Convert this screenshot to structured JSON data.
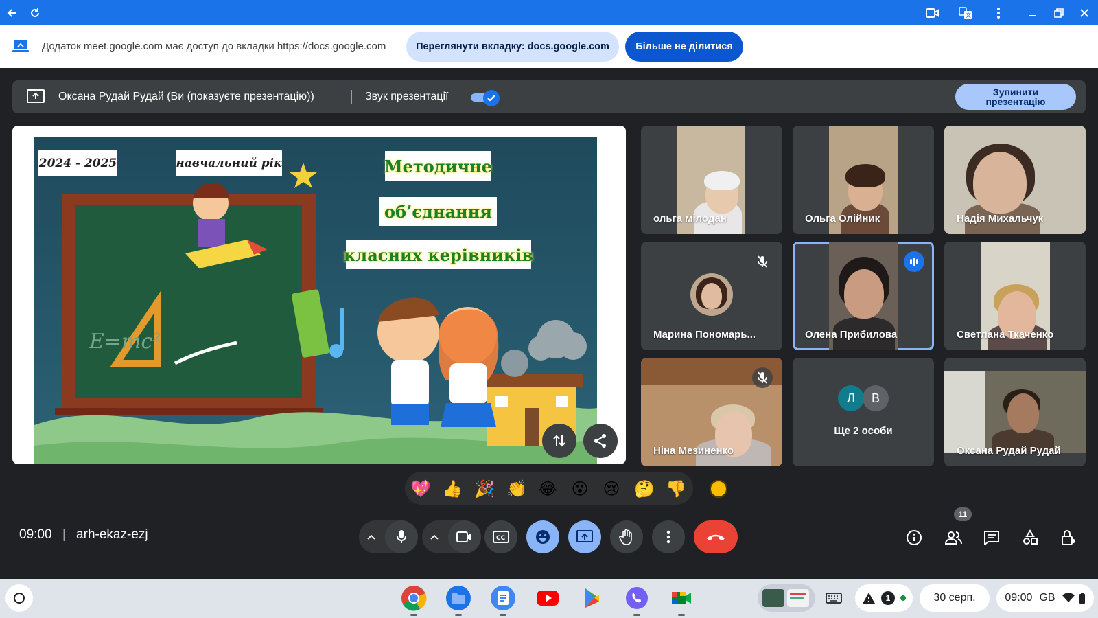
{
  "share_notice": {
    "text": "Додаток meet.google.com має доступ до вкладки https://docs.google.com",
    "view_tab_label": "Переглянути вкладку: docs.google.com",
    "stop_sharing_label": "Більше не ділитися"
  },
  "presentation_bar": {
    "presenter": "Оксана Рудай Рудай (Ви (показуєте презентацію))",
    "audio_label": "Звук презентації",
    "audio_enabled": true,
    "stop_label_line1": "Зупинити",
    "stop_label_line2": "презентацію"
  },
  "slide": {
    "year": "2024 - 2025",
    "year_caption": "навчальний рік",
    "title_line1": "Методичне",
    "title_line2": "об’єднання",
    "title_line3": "класних керівників",
    "formula": "E=mc²"
  },
  "participants": [
    {
      "name": "ольга мілодан",
      "muted": false
    },
    {
      "name": "Ольга Олійник",
      "muted": false
    },
    {
      "name": "Надія Михальчук",
      "muted": false
    },
    {
      "name": "Марина Пономарь...",
      "muted": true
    },
    {
      "name": "Олена Прибилова",
      "muted": false,
      "speaking": true
    },
    {
      "name": "Светлана Ткаченко",
      "muted": false
    },
    {
      "name": "Ніна Мезиненко",
      "muted": true
    },
    {
      "name": "Ще 2 особи",
      "avatars": [
        "Л",
        "В"
      ]
    },
    {
      "name": "Оксана Рудай Рудай",
      "muted": false
    }
  ],
  "reactions": [
    "💖",
    "👍",
    "🎉",
    "👏",
    "😂",
    "😮",
    "😢",
    "🤔",
    "👎"
  ],
  "meeting": {
    "time": "09:00",
    "code": "arh-ekaz-ezj",
    "participant_count": "11"
  },
  "shelf": {
    "date": "30 серп.",
    "time": "09:00",
    "layout": "GB",
    "notification_count": "1"
  },
  "colors": {
    "titlebar": "#1a73e8",
    "meet_bg": "#202124",
    "tile_bg": "#3c4043",
    "accent": "#8ab4f8",
    "end_call": "#ea4335"
  }
}
